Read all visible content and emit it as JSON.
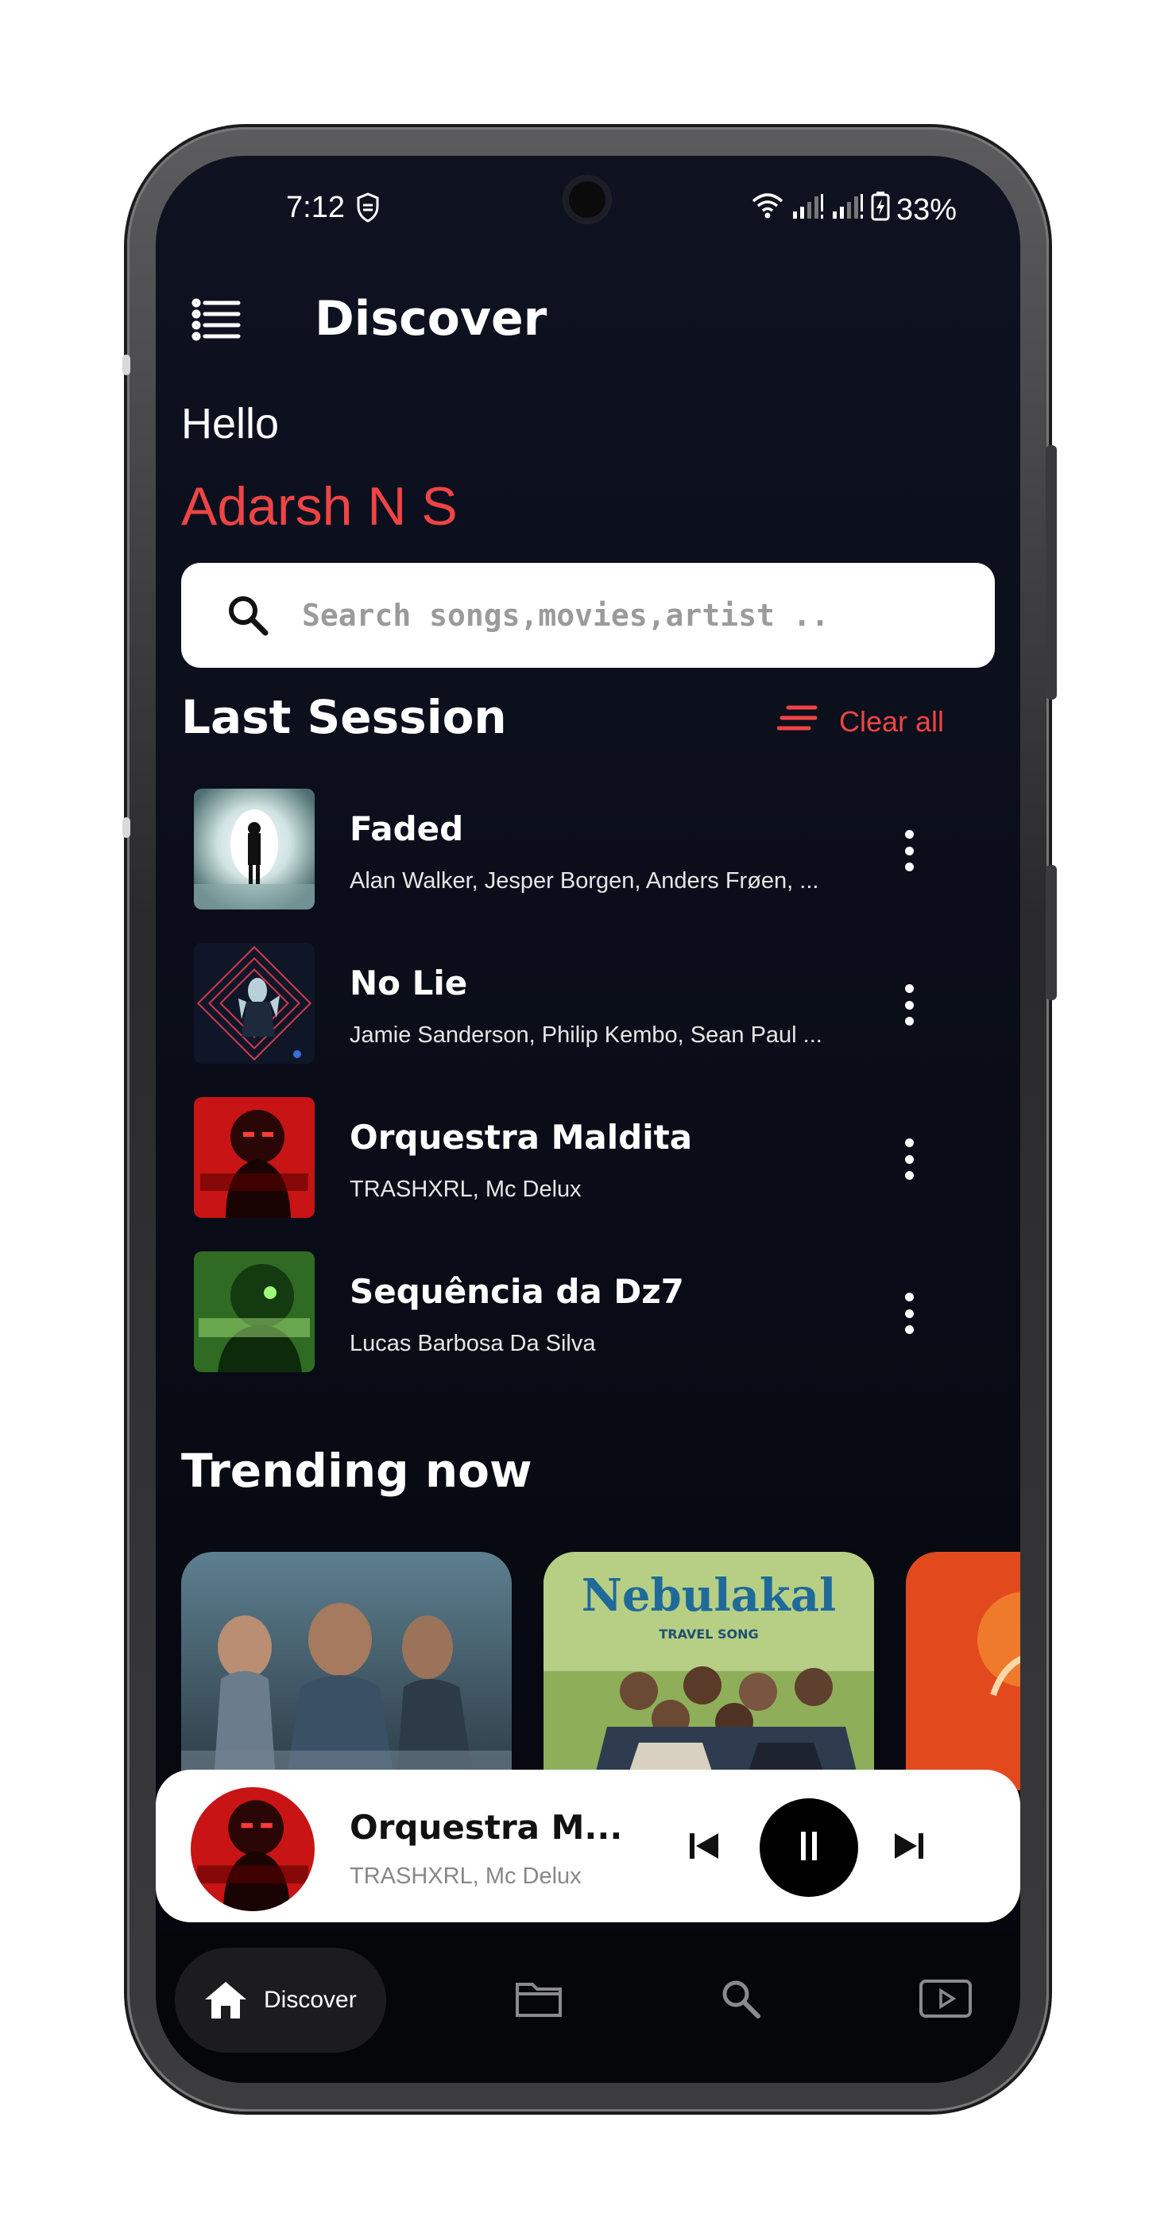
{
  "status_bar": {
    "time": "7:12",
    "battery": "33%",
    "icons": [
      "vpn-shield-icon",
      "wifi-icon",
      "signal-icon",
      "signal-icon",
      "battery-charging-icon"
    ]
  },
  "header": {
    "title": "Discover",
    "menu_icon": "list-menu-icon"
  },
  "greeting": {
    "hello": "Hello",
    "name": "Adarsh N S"
  },
  "search": {
    "placeholder": "Search songs,movies,artist .."
  },
  "last_session": {
    "heading": "Last Session",
    "clear_label": "Clear all",
    "items": [
      {
        "title": "Faded",
        "artist": "Alan Walker, Jesper Borgen, Anders Frøen, ..."
      },
      {
        "title": "No Lie",
        "artist": "Jamie Sanderson, Philip Kembo, Sean Paul ..."
      },
      {
        "title": "Orquestra Maldita",
        "artist": "TRASHXRL, Mc Delux"
      },
      {
        "title": "Sequência da Dz7",
        "artist": "Lucas Barbosa Da Silva"
      }
    ]
  },
  "trending": {
    "heading": "Trending now",
    "cards": [
      {
        "artwork": "action-movie-poster"
      },
      {
        "title": "Nebulakal",
        "subtitle": "TRAVEL SONG"
      },
      {
        "artwork": "orange-poster"
      }
    ]
  },
  "player": {
    "title": "Orquestra M...",
    "artist": "TRASHXRL, Mc Delux",
    "state": "playing",
    "colors": {
      "accent": "#ef4444"
    }
  },
  "bottom_nav": {
    "items": [
      {
        "label": "Discover",
        "icon": "home-icon",
        "active": true
      },
      {
        "label": "",
        "icon": "folder-icon"
      },
      {
        "label": "",
        "icon": "search-icon"
      },
      {
        "label": "",
        "icon": "video-play-icon"
      }
    ]
  }
}
